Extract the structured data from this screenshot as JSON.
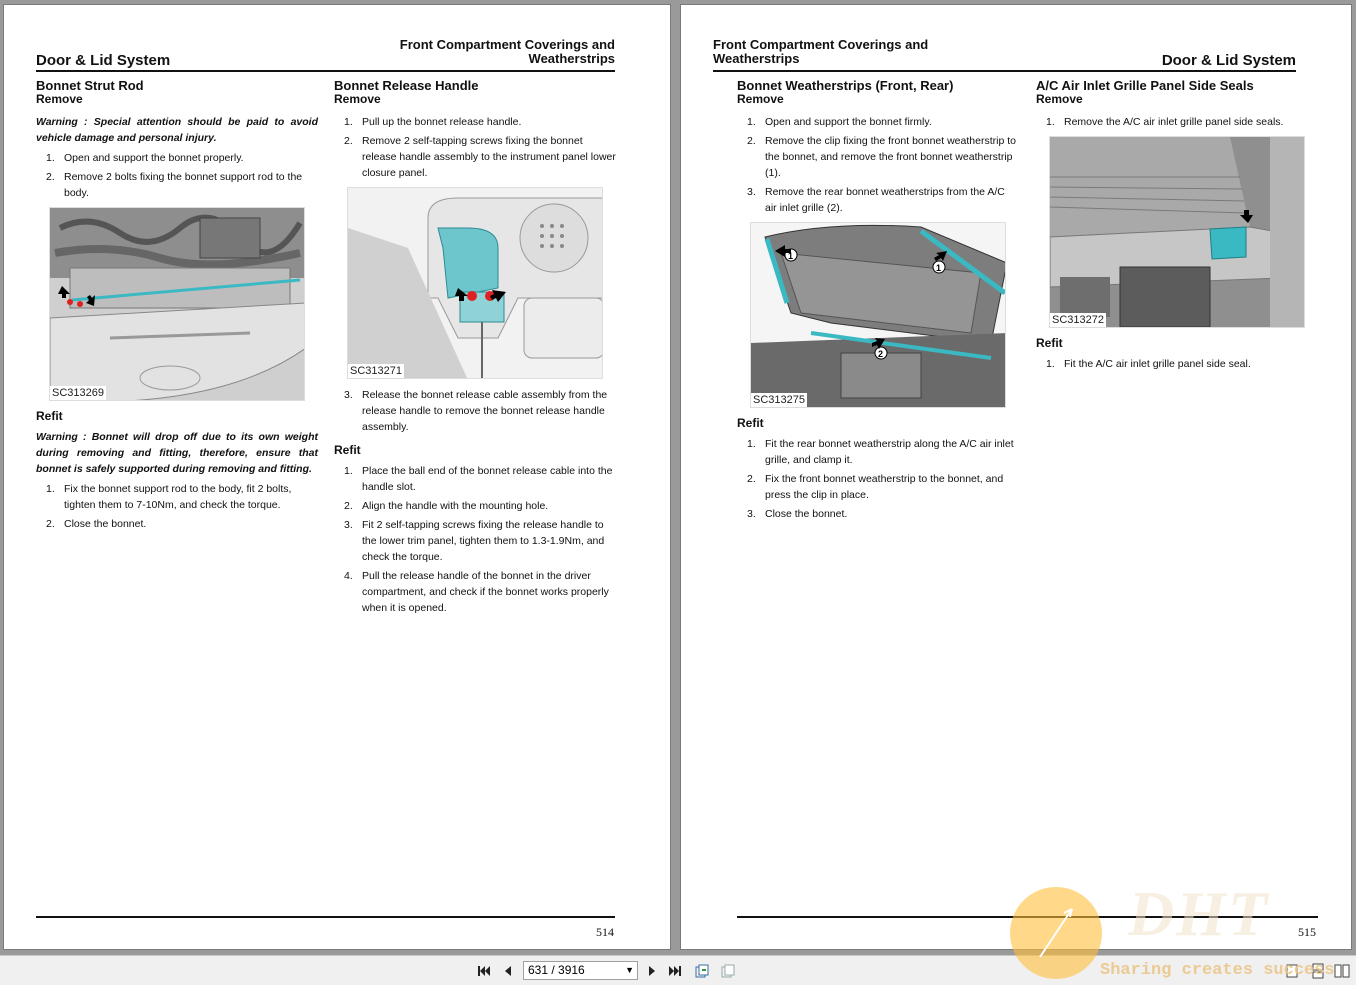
{
  "left_page": {
    "section": "Door & Lid System",
    "chapter_line1": "Front Compartment Coverings and",
    "chapter_line2": "Weatherstrips",
    "page_number": "514",
    "col1": {
      "title": "Bonnet Strut Rod",
      "subtitle": "Remove",
      "warning": "Warning : Special attention should be paid to avoid vehicle damage and personal injury.",
      "steps": [
        "Open and support the bonnet properly.",
        "Remove 2 bolts fixing the bonnet support rod to the body."
      ],
      "figure_caption": "SC313269",
      "refit_heading": "Refit",
      "refit_warning": "Warning : Bonnet will drop off due to its own weight during removing and fitting, therefore, ensure that bonnet is safely supported during removing and fitting.",
      "refit_steps": [
        "Fix the bonnet support rod to the body, fit 2 bolts, tighten them to 7-10Nm, and check the torque.",
        "Close the bonnet."
      ]
    },
    "col2": {
      "title": "Bonnet Release Handle",
      "subtitle": "Remove",
      "steps": [
        "Pull up the bonnet release handle.",
        "Remove 2 self-tapping screws fixing the bonnet release handle assembly to the instrument panel lower closure panel."
      ],
      "figure_caption": "SC313271",
      "steps_after": [
        "Release the bonnet release cable assembly from the release handle to remove the bonnet release handle assembly."
      ],
      "refit_heading": "Refit",
      "refit_steps": [
        "Place the ball end of the bonnet release cable into the handle slot.",
        "Align the handle with the mounting hole.",
        "Fit 2 self-tapping screws fixing the release handle to the lower trim panel, tighten them to 1.3-1.9Nm, and check the torque.",
        "Pull the release handle of the bonnet in the driver compartment, and check if the bonnet works properly when it is opened."
      ]
    }
  },
  "right_page": {
    "section": "Door & Lid System",
    "chapter_line1": "Front Compartment Coverings and",
    "chapter_line2": "Weatherstrips",
    "page_number": "515",
    "col1": {
      "title": "Bonnet Weatherstrips (Front, Rear)",
      "subtitle": "Remove",
      "steps": [
        "Open and support the bonnet firmly.",
        "Remove the clip fixing the front bonnet weatherstrip to the bonnet, and remove the front bonnet weatherstrip (1).",
        "Remove the rear bonnet weatherstrips from the A/C air inlet grille (2)."
      ],
      "figure_caption": "SC313275",
      "refit_heading": "Refit",
      "refit_steps": [
        "Fit the rear bonnet weatherstrip along the A/C air inlet grille, and clamp it.",
        "Fix the front bonnet weatherstrip to the bonnet, and press the clip in place.",
        "Close the bonnet."
      ]
    },
    "col2": {
      "title": "A/C Air Inlet Grille Panel Side Seals",
      "subtitle": "Remove",
      "steps": [
        "Remove the A/C air inlet grille panel side seals."
      ],
      "figure_caption": "SC313272",
      "refit_heading": "Refit",
      "refit_steps": [
        "Fit the A/C air inlet grille panel side seal."
      ]
    }
  },
  "step_numbers": [
    "1.",
    "2.",
    "3.",
    "4."
  ],
  "callouts": {
    "one": "1",
    "two": "2"
  },
  "toolbar": {
    "page_field": "631 / 3916",
    "icons": [
      "first-page-icon",
      "prev-page-icon",
      "next-page-icon",
      "last-page-icon",
      "go-back-icon",
      "go-forward-icon",
      "single-page-icon",
      "continuous-icon",
      "facing-icon"
    ]
  },
  "watermark": {
    "logo": "DHT",
    "text": "Sharing creates success"
  },
  "colors": {
    "highlight": "#3bb9c2",
    "marker_red": "#e02020",
    "rule": "#111111"
  }
}
